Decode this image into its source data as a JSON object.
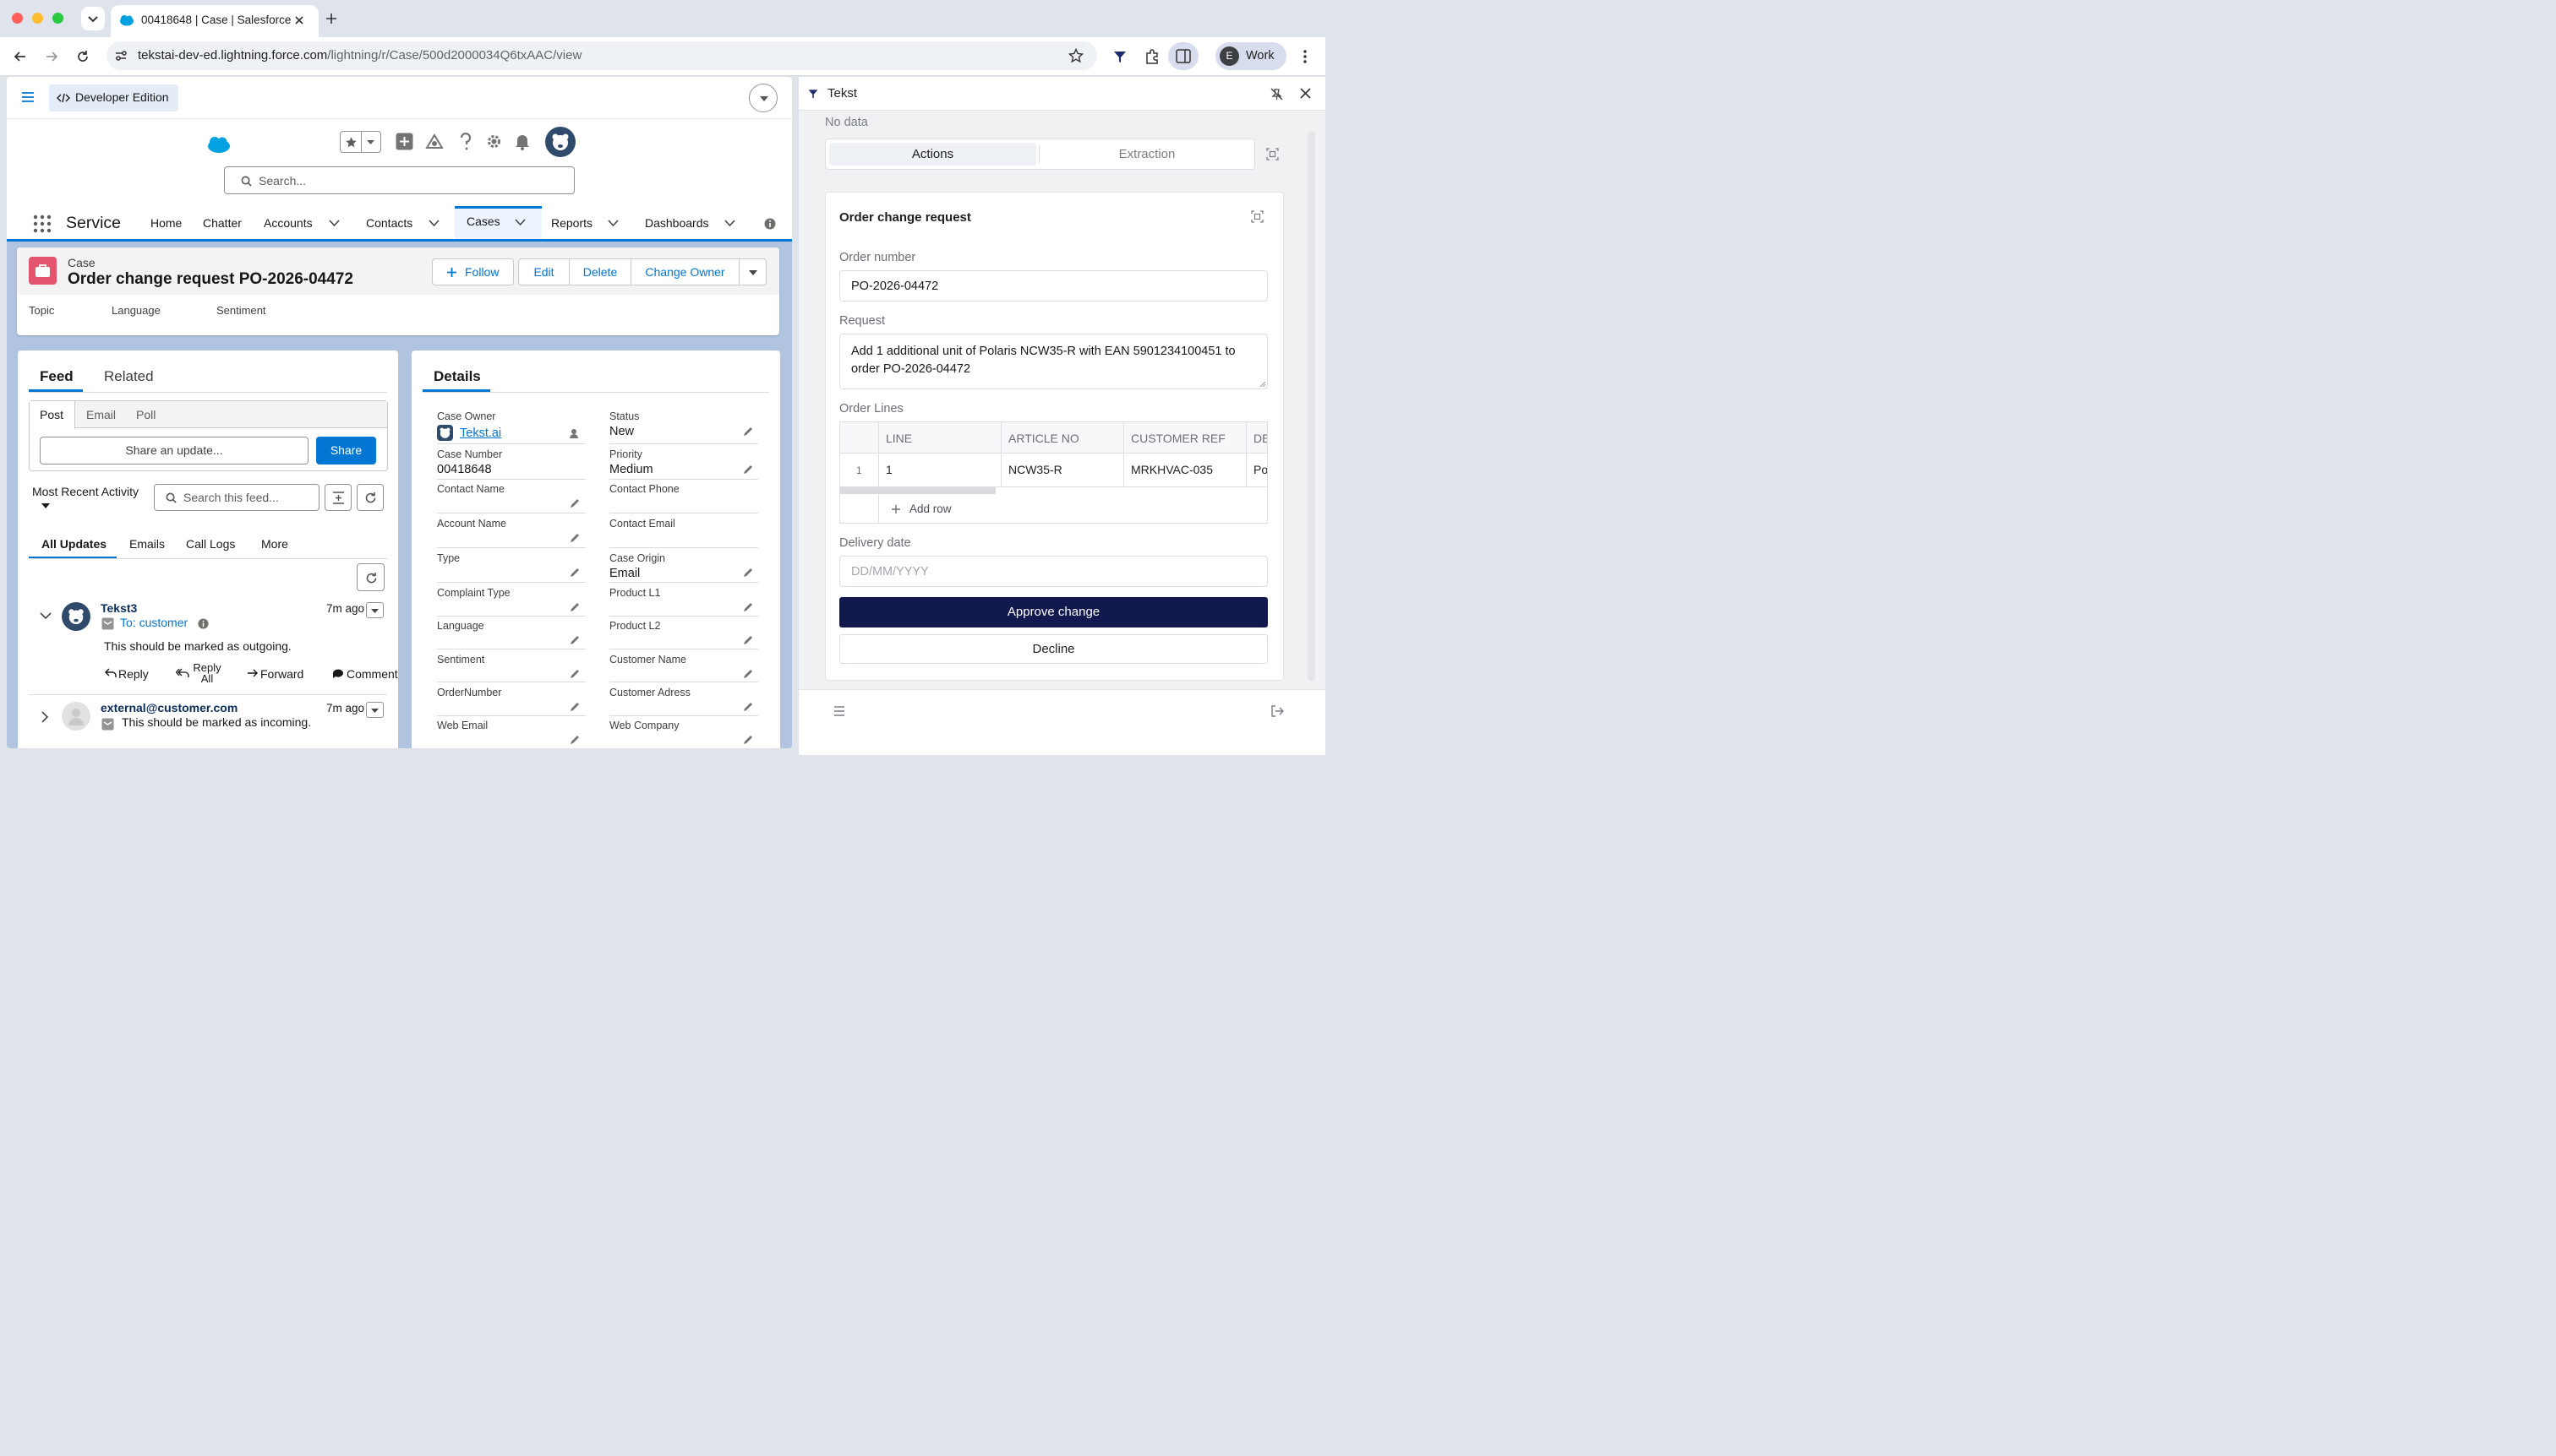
{
  "browser": {
    "tab_title": "00418648 | Case | Salesforce",
    "url_domain": "tekstai-dev-ed.lightning.force.com",
    "url_path": "/lightning/r/Case/500d2000034Q6txAAC/view",
    "profile_initial": "E",
    "profile_label": "Work"
  },
  "sf": {
    "dev_edition_label": "Developer Edition",
    "search_placeholder": "Search...",
    "app_name": "Service",
    "nav": {
      "home": "Home",
      "chatter": "Chatter",
      "accounts": "Accounts",
      "contacts": "Contacts",
      "cases": "Cases",
      "reports": "Reports",
      "dashboards": "Dashboards"
    },
    "case": {
      "object_label": "Case",
      "title": "Order change request PO-2026-04472",
      "follow": "Follow",
      "edit": "Edit",
      "delete": "Delete",
      "change_owner": "Change Owner",
      "highlights": [
        "Topic",
        "Language",
        "Sentiment"
      ]
    },
    "feed": {
      "tab_feed": "Feed",
      "tab_related": "Related",
      "publisher_tabs": [
        "Post",
        "Email",
        "Poll"
      ],
      "share_placeholder": "Share an update...",
      "share_button": "Share",
      "sort_label": "Most Recent Activity",
      "search_placeholder": "Search this feed...",
      "filters": [
        "All Updates",
        "Emails",
        "Call Logs",
        "More"
      ],
      "items": [
        {
          "author": "Tekst3",
          "time": "7m ago",
          "to": "To: customer",
          "body": "This should be marked as outgoing.",
          "actions": [
            "Reply",
            "Reply All",
            "Forward",
            "Comment"
          ]
        },
        {
          "author": "external@customer.com",
          "time": "7m ago",
          "body": "This should be marked as incoming."
        }
      ]
    },
    "details": {
      "title": "Details",
      "case_owner_label": "Case Owner",
      "case_owner_value": "Tekst.ai",
      "status_label": "Status",
      "status_value": "New",
      "case_number_label": "Case Number",
      "case_number_value": "00418648",
      "priority_label": "Priority",
      "priority_value": "Medium",
      "contact_name_label": "Contact Name",
      "contact_phone_label": "Contact Phone",
      "account_name_label": "Account Name",
      "contact_email_label": "Contact Email",
      "type_label": "Type",
      "case_origin_label": "Case Origin",
      "case_origin_value": "Email",
      "complaint_type_label": "Complaint Type",
      "product_l1_label": "Product L1",
      "language_label": "Language",
      "product_l2_label": "Product L2",
      "sentiment_label": "Sentiment",
      "customer_name_label": "Customer Name",
      "ordernumber_label": "OrderNumber",
      "customer_adress_label": "Customer Adress",
      "web_email_label": "Web Email",
      "web_company_label": "Web Company"
    }
  },
  "tekst": {
    "title": "Tekst",
    "no_data": "No data",
    "tab_actions": "Actions",
    "tab_extraction": "Extraction",
    "card_title": "Order change request",
    "order_number_label": "Order number",
    "order_number_value": "PO-2026-04472",
    "request_label": "Request",
    "request_value": "Add 1 additional unit of Polaris NCW35-R with EAN 5901234100451 to order PO-2026-04472",
    "order_lines_label": "Order Lines",
    "columns": [
      "LINE",
      "ARTICLE NO",
      "CUSTOMER REF",
      "DE"
    ],
    "rows": [
      {
        "idx": "1",
        "line": "1",
        "article": "NCW35-R",
        "ref": "MRKHVAC-035",
        "desc": "Po"
      }
    ],
    "add_row": "Add row",
    "delivery_label": "Delivery date",
    "delivery_placeholder": "DD/MM/YYYY",
    "approve": "Approve change",
    "decline": "Decline"
  }
}
